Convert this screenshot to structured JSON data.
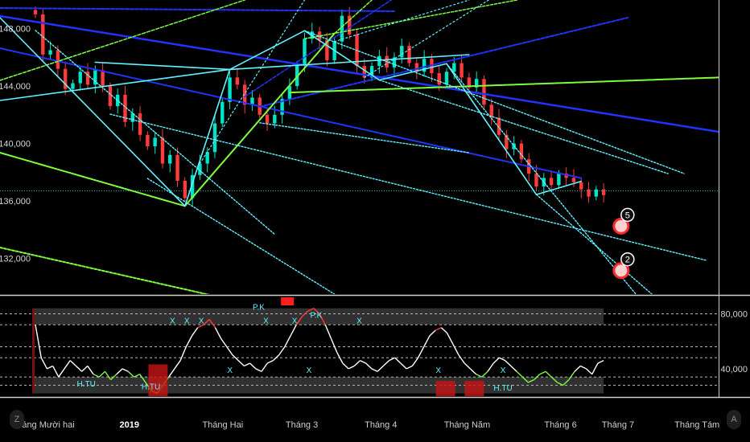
{
  "chart_data": [
    {
      "type": "candlestick",
      "title": "",
      "xlabel": "",
      "ylabel": "",
      "ylim": [
        129500,
        150000
      ],
      "y_ticks": [
        "148,000",
        "144,000",
        "140,000",
        "136,000",
        "132,000"
      ],
      "y_tick_values": [
        148000,
        144000,
        140000,
        136000,
        132000
      ],
      "x_ticks": [
        "Tháng Mười hai",
        "2019",
        "Tháng Hai",
        "Tháng 3",
        "Tháng 4",
        "Tháng Năm",
        "Tháng 6",
        "Tháng 7",
        "Tháng Tám"
      ],
      "x_tick_bold": [
        "2019"
      ],
      "x_range": [
        0,
        100
      ],
      "x_tick_positions": [
        6,
        18,
        31,
        42,
        53,
        65,
        78,
        86,
        97
      ],
      "last_bar_x": 84,
      "close": [
        149000,
        146200,
        146500,
        145200,
        143800,
        144200,
        145000,
        144100,
        145100,
        144000,
        142600,
        143400,
        141500,
        142100,
        140600,
        139800,
        140400,
        138600,
        139200,
        137400,
        136200,
        137800,
        138600,
        139400,
        141400,
        142900,
        144600,
        144100,
        142700,
        143200,
        142000,
        141400,
        142000,
        143100,
        144000,
        145500,
        147300,
        147800,
        147200,
        145800,
        147100,
        148900,
        147600,
        145400,
        144600,
        145400,
        146100,
        145300,
        146000,
        146800,
        145600,
        145000,
        145900,
        144900,
        144100,
        145000,
        145600,
        144600,
        143900,
        144500,
        142700,
        141800,
        140600,
        139600,
        140000,
        138900,
        137900,
        137000,
        137600,
        137100,
        137900,
        137600,
        137300,
        136800,
        136300,
        136800,
        136400
      ],
      "price_line": 136700,
      "annotations": [
        "5",
        "2"
      ],
      "annotation_values": [
        134800,
        131700
      ],
      "annotation_x": [
        88,
        88
      ]
    },
    {
      "type": "line",
      "title": "",
      "ylim": [
        20000,
        92000
      ],
      "y_ticks": [
        "80,000",
        "40,000"
      ],
      "y_tick_values": [
        80000,
        40000
      ],
      "levels": [
        28000,
        34000,
        48000,
        56000,
        72000,
        80000
      ],
      "values": [
        72000,
        48000,
        40000,
        42000,
        34000,
        40000,
        46000,
        42000,
        38000,
        42000,
        36000,
        34000,
        38000,
        32000,
        36000,
        40000,
        38000,
        34000,
        36000,
        30000,
        24000,
        22000,
        28000,
        34000,
        40000,
        46000,
        56000,
        64000,
        70000,
        72000,
        76000,
        70000,
        62000,
        56000,
        50000,
        46000,
        42000,
        44000,
        40000,
        38000,
        44000,
        46000,
        50000,
        56000,
        64000,
        72000,
        78000,
        82000,
        84000,
        80000,
        72000,
        62000,
        52000,
        44000,
        40000,
        42000,
        46000,
        44000,
        40000,
        38000,
        42000,
        46000,
        48000,
        44000,
        40000,
        42000,
        48000,
        56000,
        64000,
        68000,
        70000,
        66000,
        58000,
        50000,
        44000,
        40000,
        36000,
        34000,
        38000,
        44000,
        48000,
        46000,
        42000,
        38000,
        34000,
        30000,
        32000,
        36000,
        38000,
        34000,
        30000,
        28000,
        32000,
        38000,
        42000,
        40000,
        36000,
        44000,
        46000
      ],
      "labels": [
        "P.K",
        "P.K",
        "X",
        "X",
        "X",
        "X",
        "X",
        "X",
        "X",
        "X",
        "X",
        "X",
        "H.TU",
        "H.TU",
        "H.TU"
      ],
      "label_values": [
        83000,
        77000,
        73000,
        73000,
        73000,
        73000,
        73000,
        73000,
        37000,
        37000,
        37000,
        37000,
        27000,
        25000,
        24000
      ],
      "label_x": [
        36,
        44,
        24,
        26,
        28,
        37,
        41,
        50,
        32,
        43,
        61,
        70,
        12,
        21,
        70
      ]
    }
  ],
  "colors": {
    "background": "#000000",
    "up": "#00e5c7",
    "down": "#ff3b3b",
    "cyan": "#5ff4ff",
    "blue": "#2233ff",
    "green": "#7cff3c",
    "grid": "#b7b7b7",
    "osc_line": "#ffffff",
    "band": "#5a5a5a"
  },
  "ui": {
    "left_button": "Z",
    "right_button": "A"
  }
}
